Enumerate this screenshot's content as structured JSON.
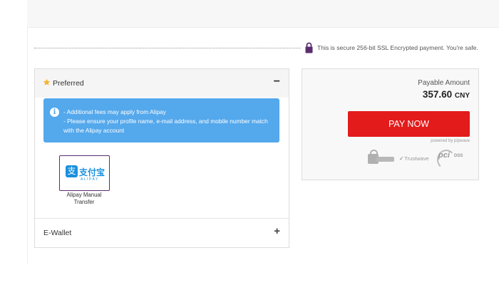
{
  "security": {
    "message": "This is secure 256-bit SSL Encrypted payment. You're safe."
  },
  "payment_methods": {
    "preferred": {
      "label": "Preferred",
      "collapse_symbol": "−",
      "info_lines": [
        "- Additional fees may apply from Alipay",
        "- Please ensure your profile name, e-mail address, and mobile number match",
        "with the Alipay account"
      ],
      "option": {
        "logo_cn": "支付宝",
        "logo_glyph": "支",
        "logo_en": "ALIPAY",
        "caption_line1": "Alipay Manual",
        "caption_line2": "Transfer"
      }
    },
    "ewallet": {
      "label": "E-Wallet",
      "expand_symbol": "+"
    }
  },
  "summary": {
    "payable_label": "Payable Amount",
    "amount": "357.60",
    "currency": "CNY",
    "pay_button": "PAY NOW",
    "powered_by": "powered by pipwave",
    "badges": {
      "trustwave": "Trustwave",
      "pci": "pci",
      "dss": "DSS"
    }
  },
  "colors": {
    "pay_button": "#e31b1b",
    "info_box": "#54a8ec",
    "alipay_blue": "#1a90de",
    "lock": "#5a2e6e",
    "star": "#f5b52e"
  }
}
